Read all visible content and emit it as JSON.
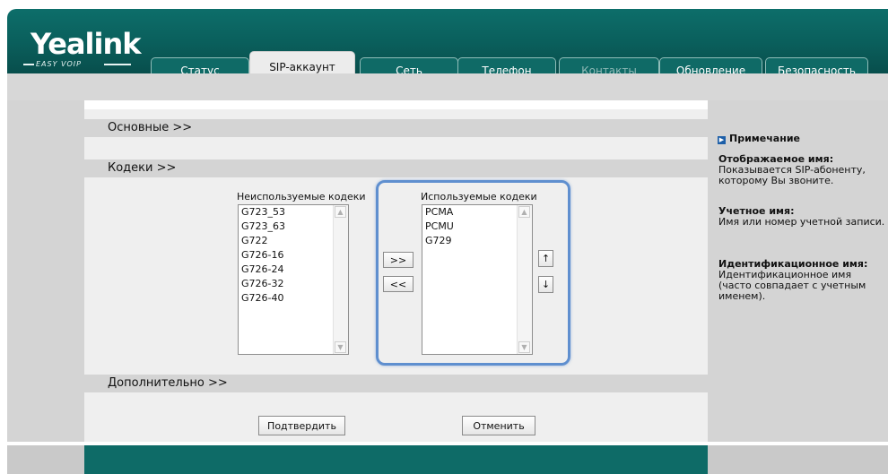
{
  "brand": {
    "logo": "Yealink",
    "tagline": "EASY VOIP"
  },
  "tabs": [
    {
      "label": "Статус"
    },
    {
      "label": "SIP-аккаунт"
    },
    {
      "label": "Сеть"
    },
    {
      "label": "Телефон"
    },
    {
      "label": "Контакты"
    },
    {
      "label": "Обновление"
    },
    {
      "label": "Безопасность"
    }
  ],
  "sections": {
    "basic": "Основные >>",
    "codecs": "Кодеки >>",
    "advanced": "Дополнительно >>"
  },
  "codecs": {
    "unused_title": "Неиспользуемые кодеки",
    "unused": [
      "G723_53",
      "G723_63",
      "G722",
      "G726-16",
      "G726-24",
      "G726-32",
      "G726-40"
    ],
    "used_title": "Используемые кодеки",
    "used": [
      "PCMA",
      "PCMU",
      "G729"
    ],
    "move_right": ">>",
    "move_left": "<<",
    "move_up": "↑",
    "move_down": "↓"
  },
  "actions": {
    "confirm": "Подтвердить",
    "cancel": "Отменить"
  },
  "notes": {
    "header": "Примечание",
    "items": [
      {
        "title": "Отображаемое имя:",
        "text": "Показывается SIP-абоненту, которому Вы звоните."
      },
      {
        "title": "Учетное имя:",
        "text": "Имя или номер учетной записи."
      },
      {
        "title": "Идентификационное имя:",
        "text": "Идентификационное имя (часто совпадает с учетным именем)."
      }
    ]
  },
  "colors": {
    "header": "#0a5e5b",
    "highlight": "#5f8fcf",
    "note_icon": "#1d5fa8"
  }
}
